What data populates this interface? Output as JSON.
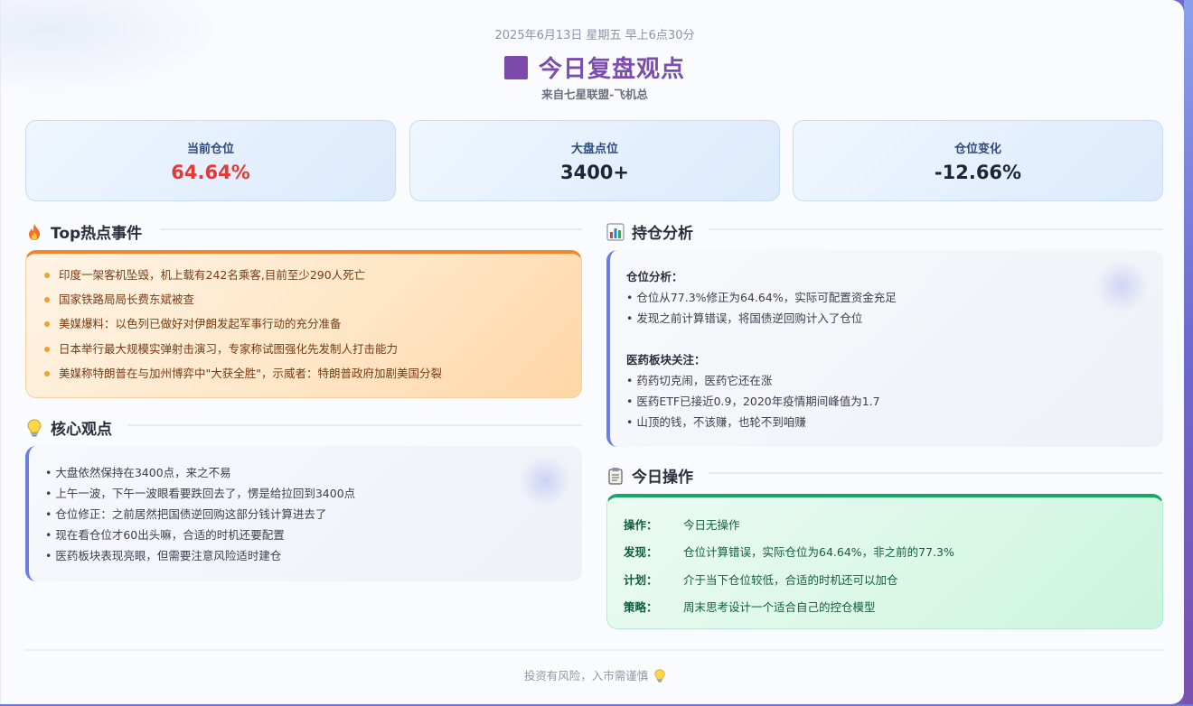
{
  "header": {
    "date": "2025年6月13日 星期五 早上6点30分",
    "title": "今日复盘观点",
    "subtitle": "来自七星联盟-飞机总"
  },
  "stats": [
    {
      "label": "当前仓位",
      "value": "64.64%"
    },
    {
      "label": "大盘点位",
      "value": "3400+"
    },
    {
      "label": "仓位变化",
      "value": "-12.66%"
    }
  ],
  "hot": {
    "title": "Top热点事件",
    "icon": "fire-icon",
    "items": [
      "印度一架客机坠毁，机上载有242名乘客,目前至少290人死亡",
      "国家铁路局局长费东斌被查",
      "美媒爆料：以色列已做好对伊朗发起军事行动的充分准备",
      "日本举行最大规模实弹射击演习，专家称试图强化先发制人打击能力",
      "美媒称特朗普在与加州博弈中\"大获全胜\"，示威者：特朗普政府加剧美国分裂"
    ]
  },
  "views": {
    "title": "核心观点",
    "icon": "lightbulb-icon",
    "lines": [
      "• 大盘依然保持在3400点，来之不易",
      "• 上午一波，下午一波眼看要跌回去了，愣是给拉回到3400点",
      "• 仓位修正：之前居然把国债逆回购这部分钱计算进去了",
      "• 现在看仓位才60出头嘛，合适的时机还要配置",
      "• 医药板块表现亮眼，但需要注意风险适时建仓"
    ]
  },
  "holdings": {
    "title": "持仓分析",
    "icon": "bar-chart-icon",
    "position_head": "仓位分析：",
    "position_lines": [
      "• 仓位从77.3%修正为64.64%，实际可配置资金充足",
      "• 发现之前计算错误，将国债逆回购计入了仓位"
    ],
    "pharma_head": "医药板块关注：",
    "pharma_lines": [
      "• 药药切克闹，医药它还在涨",
      "• 医药ETF已接近0.9，2020年疫情期间峰值为1.7",
      "• 山顶的钱，不该赚，也轮不到咱赚"
    ]
  },
  "ops": {
    "title": "今日操作",
    "icon": "clipboard-icon",
    "rows": [
      {
        "key": "操作：",
        "val": "今日无操作"
      },
      {
        "key": "发现：",
        "val": "仓位计算错误，实际仓位为64.64%，非之前的77.3%"
      },
      {
        "key": "计划：",
        "val": "介于当下仓位较低，合适的时机还可以加仓"
      },
      {
        "key": "策略：",
        "val": "周末思考设计一个适合自己的控仓模型"
      }
    ]
  },
  "footer": {
    "text": "投资有风险，入市需谨慎",
    "icon": "lightbulb-icon"
  },
  "colors": {
    "title": "#7b4eae",
    "negative": "#e53935",
    "hot_accent": "#f0882b",
    "ops_accent": "#17a56a",
    "view_accent": "#6b7fe0"
  }
}
